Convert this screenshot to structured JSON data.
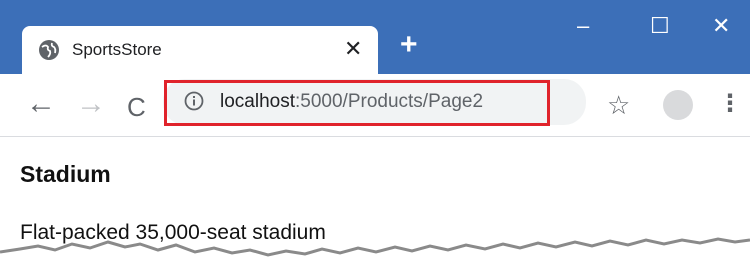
{
  "browser": {
    "tab": {
      "title": "SportsStore",
      "favicon": "globe-icon",
      "close_glyph": "✕"
    },
    "new_tab_glyph": "+",
    "window_controls": {
      "minimize": "–",
      "maximize": "☐",
      "close": "✕"
    },
    "toolbar": {
      "back": "←",
      "forward": "→",
      "reload": "C",
      "url_host": "localhost",
      "url_path": ":5000/Products/Page2",
      "bookmark_icon": "star-icon",
      "menu_glyph": "⋮"
    },
    "colors": {
      "title_bar": "#3c6fb8",
      "highlight": "#e0232b",
      "omnibox": "#f1f3f4"
    }
  },
  "page": {
    "product_name": "Stadium",
    "product_description": "Flat-packed 35,000-seat stadium"
  }
}
